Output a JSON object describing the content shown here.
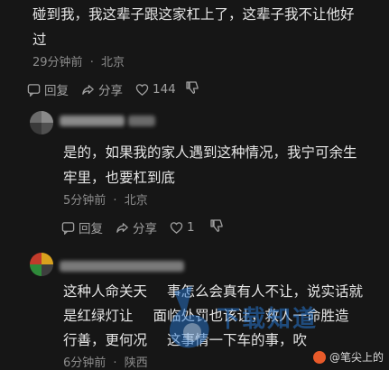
{
  "comments": [
    {
      "text_line1": "碰到我，我这辈子跟这家杠上了，这辈子我不让他好",
      "text_line2": "过",
      "time": "29分钟前",
      "location": "北京",
      "reply_label": "回复",
      "share_label": "分享",
      "like_count": "144"
    },
    {
      "text_line1": "是的，如果我的家人遇到这种情况，我宁可余生",
      "text_line2": "牢里，也要杠到底",
      "time": "5分钟前",
      "location": "北京",
      "reply_label": "回复",
      "share_label": "分享",
      "like_count": "1"
    },
    {
      "text_line1": "这种人命关天",
      "text_line1b": "事怎么会真有人不让，说实话就",
      "text_line2": "是红绿灯让",
      "text_line2b": "面临处罚也该让，救人一命胜造",
      "text_line3": "行善，更何况",
      "text_line3b": "这事情一下车的事，吹",
      "time": "6分钟前",
      "location": "陕西"
    }
  ],
  "separator": "·",
  "watermark": {
    "text": "下载知道"
  },
  "credit": {
    "text": "@笔尖上的"
  },
  "colors": {
    "background": "#161616",
    "text": "#e6e6e6",
    "meta": "#8c8c8c",
    "watermark": "#2878d2"
  }
}
